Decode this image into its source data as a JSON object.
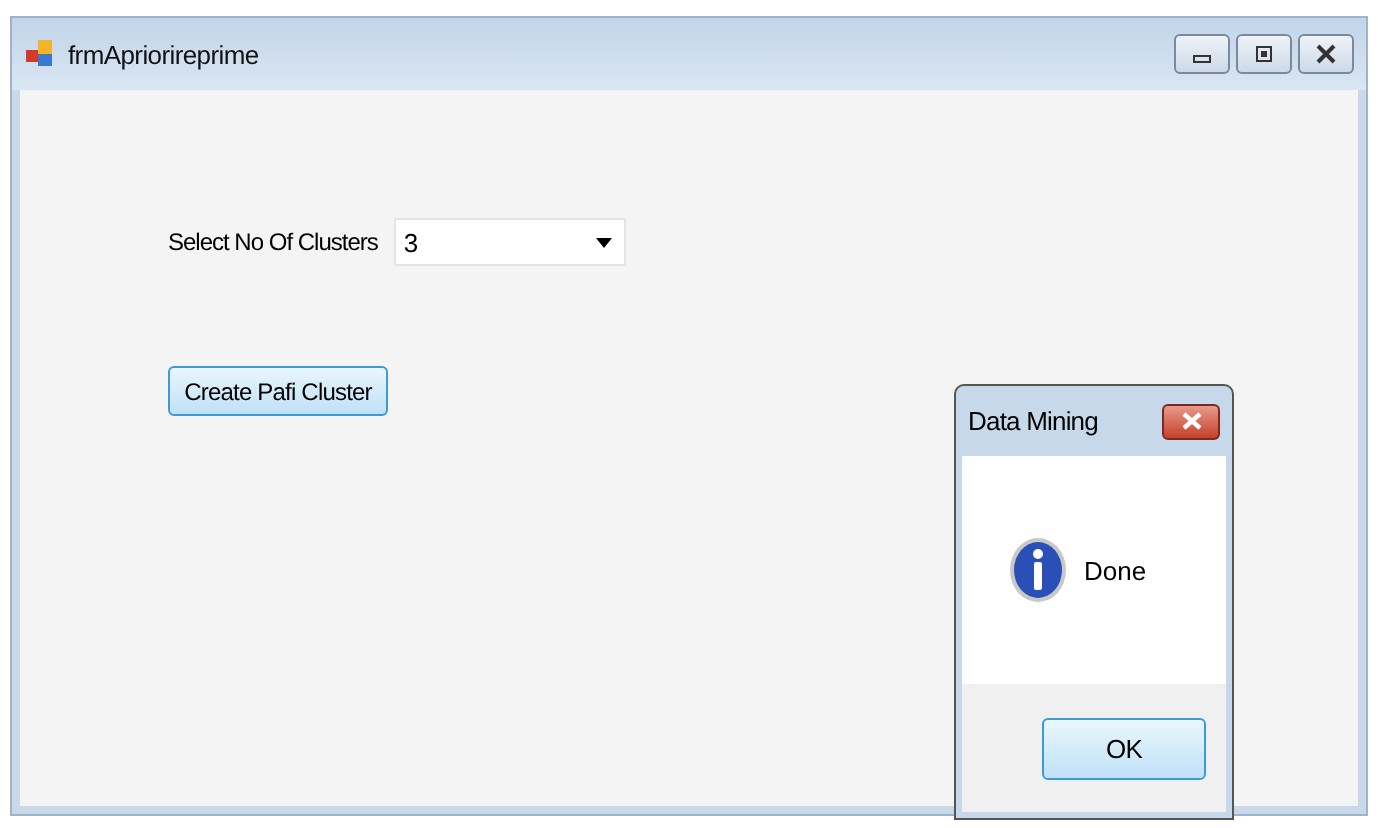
{
  "window": {
    "title": "frmApriorireprime"
  },
  "form": {
    "cluster_label": "Select No Of Clusters",
    "cluster_select": {
      "value": "3"
    },
    "create_button": "Create Pafi Cluster"
  },
  "dialog": {
    "title": "Data Mining",
    "message": "Done",
    "button": "OK"
  }
}
